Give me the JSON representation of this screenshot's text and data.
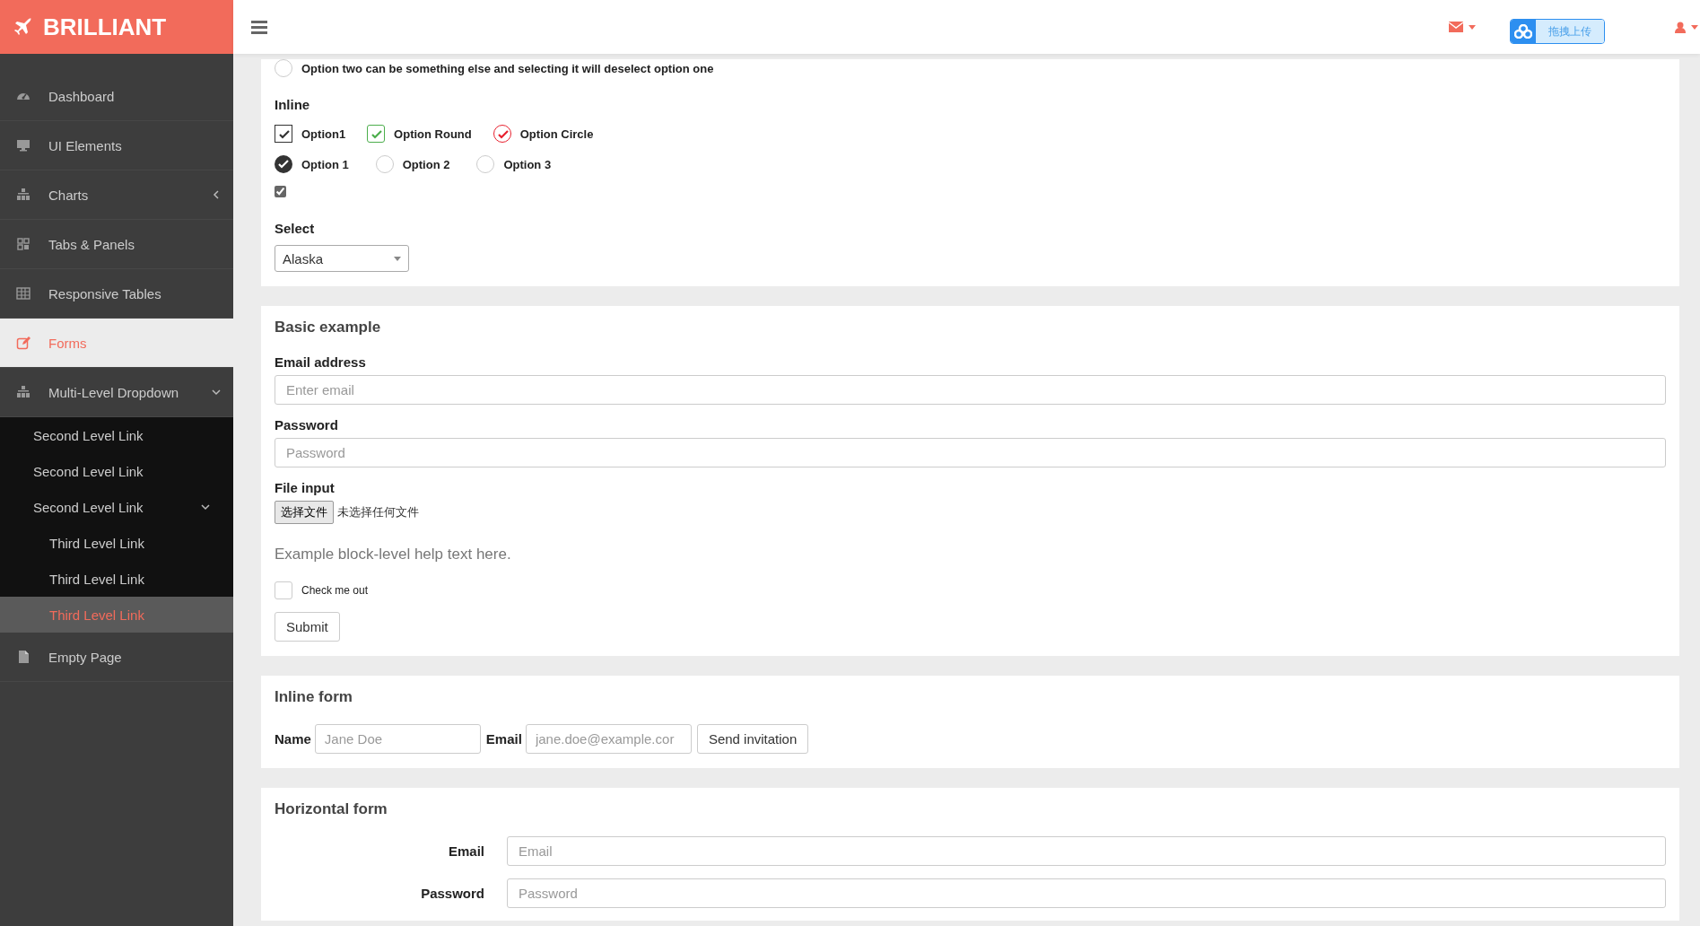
{
  "brand": {
    "name": "BRILLIANT"
  },
  "topbar": {
    "upload_widget": {
      "label": "拖拽上传"
    }
  },
  "sidebar": {
    "items": [
      {
        "label": "Dashboard",
        "selected": false
      },
      {
        "label": "UI Elements",
        "selected": false
      },
      {
        "label": "Charts",
        "selected": false,
        "expanded": false
      },
      {
        "label": "Tabs & Panels",
        "selected": false
      },
      {
        "label": "Responsive Tables",
        "selected": false
      },
      {
        "label": "Forms",
        "selected": true
      },
      {
        "label": "Multi-Level Dropdown",
        "selected": false,
        "expanded": true,
        "children": [
          {
            "label": "Second Level Link",
            "selected": false
          },
          {
            "label": "Second Level Link",
            "selected": false
          },
          {
            "label": "Second Level Link",
            "selected": false,
            "expanded": true,
            "children": [
              {
                "label": "Third Level Link",
                "selected": false
              },
              {
                "label": "Third Level Link",
                "selected": false
              },
              {
                "label": "Third Level Link",
                "selected": true
              }
            ]
          }
        ]
      },
      {
        "label": "Empty Page",
        "selected": false
      }
    ]
  },
  "panels": [
    {
      "kind": "choices",
      "radio_top": {
        "label": "Option two can be something else and selecting it will deselect option one",
        "selected": false
      },
      "inline_heading": "Inline",
      "checkboxes": [
        {
          "label": "Option1",
          "kind": "square",
          "color": "#333333",
          "checked": true
        },
        {
          "label": "Option Round",
          "kind": "rounded",
          "color": "#4cae4c",
          "checked": true
        },
        {
          "label": "Option Circle",
          "kind": "circle",
          "color": "#e8202e",
          "checked": true
        }
      ],
      "radios": [
        {
          "label": "Option 1",
          "selected": true
        },
        {
          "label": "Option 2",
          "selected": false
        },
        {
          "label": "Option 3",
          "selected": false
        }
      ],
      "plain_checkbox": {
        "checked": true
      },
      "select": {
        "label": "Select",
        "value": "Alaska"
      }
    },
    {
      "kind": "basic",
      "title": "Basic example",
      "fields": [
        {
          "label": "Email address",
          "placeholder": "Enter email"
        },
        {
          "label": "Password",
          "placeholder": "Password"
        }
      ],
      "file_input": {
        "label": "File input",
        "button": "选择文件",
        "status": "未选择任何文件"
      },
      "help": "Example block-level help text here.",
      "check": {
        "label": "Check me out",
        "checked": false
      },
      "submit": "Submit"
    },
    {
      "kind": "inline",
      "title": "Inline form",
      "fields": [
        {
          "label": "Name",
          "placeholder": "Jane Doe"
        },
        {
          "label": "Email",
          "placeholder": "jane.doe@example.cor"
        }
      ],
      "button": "Send invitation"
    },
    {
      "kind": "horizontal",
      "title": "Horizontal form",
      "fields": [
        {
          "label": "Email",
          "placeholder": "Email"
        },
        {
          "label": "Password",
          "placeholder": "Password"
        }
      ]
    }
  ]
}
